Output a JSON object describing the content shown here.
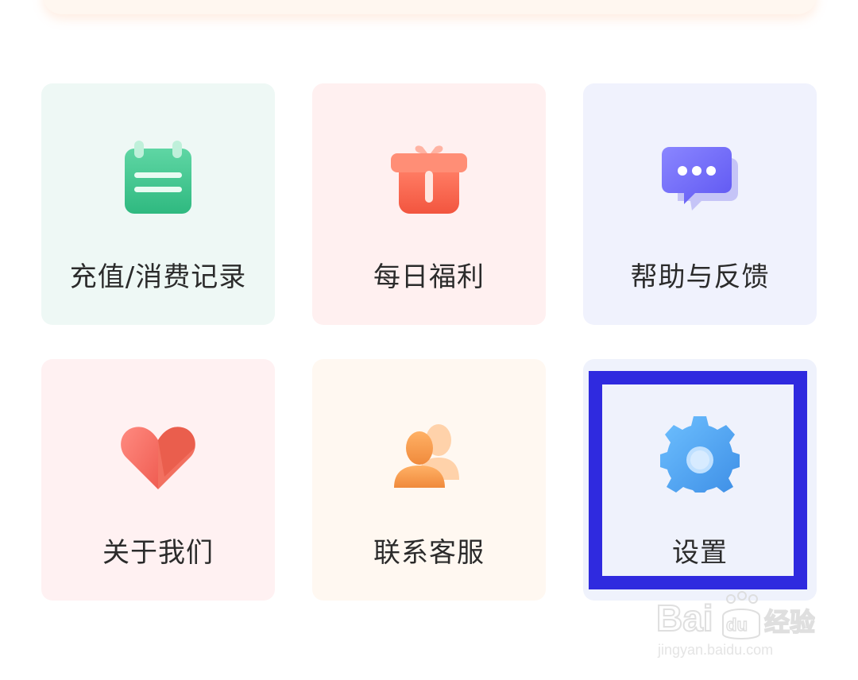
{
  "menu": {
    "items": [
      {
        "label": "充值/消费记录",
        "icon": "calendar-list-icon",
        "bg": "#eef8f5"
      },
      {
        "label": "每日福利",
        "icon": "gift-box-icon",
        "bg": "#fff0f0"
      },
      {
        "label": "帮助与反馈",
        "icon": "chat-bubble-icon",
        "bg": "#f0f2fd"
      },
      {
        "label": "关于我们",
        "icon": "heart-icon",
        "bg": "#fff1f2"
      },
      {
        "label": "联系客服",
        "icon": "users-icon",
        "bg": "#fff8f1"
      },
      {
        "label": "设置",
        "icon": "gear-icon",
        "bg": "#eff2fc"
      }
    ]
  },
  "annotation": {
    "highlight_color": "#2f2adf",
    "highlighted_item": "设置"
  },
  "watermark": {
    "brand": "Baidu经验",
    "url": "jingyan.baidu.com"
  }
}
